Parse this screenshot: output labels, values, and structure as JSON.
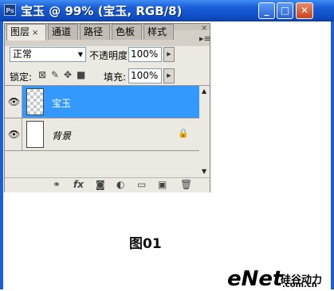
{
  "window": {
    "app_icon": "Ps",
    "title": "宝玉 @ 99% (宝玉, RGB/8)",
    "min_label": "_",
    "max_label": "□",
    "close_label": "✕"
  },
  "panel": {
    "tabs": [
      {
        "label": "图层",
        "close": "×"
      },
      {
        "label": "通道"
      },
      {
        "label": "路径"
      },
      {
        "label": "色板"
      },
      {
        "label": "样式"
      }
    ],
    "menu_icon": "▸≡",
    "blend_mode": "正常",
    "opacity_label": "不透明度:",
    "opacity_value": "100%",
    "lock_label": "锁定:",
    "fill_label": "填充:",
    "fill_value": "100%",
    "layers": [
      {
        "name": "宝玉",
        "selected": true,
        "visible": true
      },
      {
        "name": "背景",
        "selected": false,
        "visible": true,
        "locked": true
      }
    ],
    "bottom_icons": [
      "link-icon",
      "fx-icon",
      "mask-icon",
      "adjustment-icon",
      "folder-icon",
      "new-layer-icon",
      "trash-icon"
    ],
    "fx_label": "fx"
  },
  "caption": "图01",
  "watermark": {
    "text": "eNet",
    "cn": "硅谷动力",
    "com": ".com.cn"
  },
  "colors": {
    "titlebar": "#1a5fd6",
    "selected_row": "#3399ff",
    "panel_bg": "#ece9e2"
  }
}
